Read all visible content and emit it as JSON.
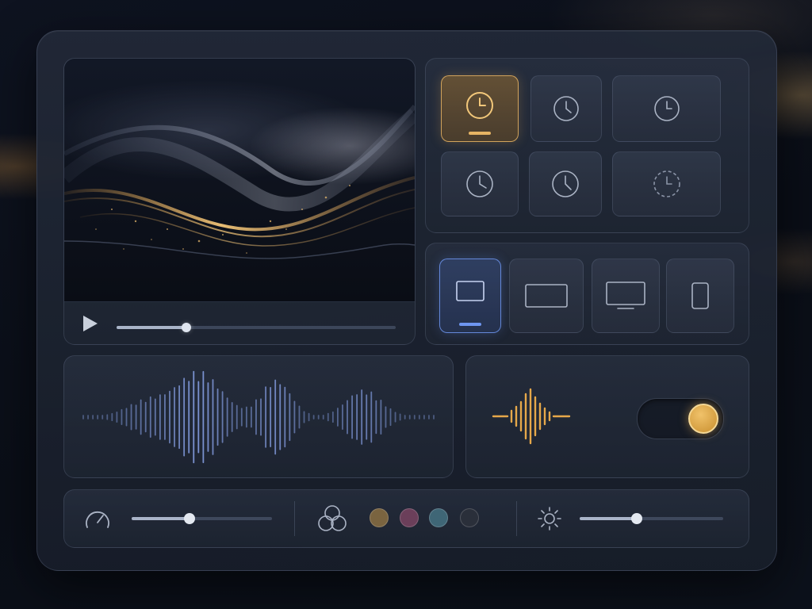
{
  "video": {
    "progress": 0.25
  },
  "clock_presets": [
    {
      "icon": "clock-icon",
      "active": true
    },
    {
      "icon": "clock-icon",
      "active": false
    },
    {
      "icon": "clock-icon",
      "active": false
    },
    {
      "icon": "clock-icon",
      "active": false
    },
    {
      "icon": "clock-icon",
      "active": false
    },
    {
      "icon": "clock-dashed-icon",
      "active": false
    }
  ],
  "screen_formats": [
    {
      "icon": "tablet-landscape-icon",
      "active": true
    },
    {
      "icon": "widescreen-icon",
      "active": false
    },
    {
      "icon": "monitor-icon",
      "active": false
    },
    {
      "icon": "phone-portrait-icon",
      "active": false
    }
  ],
  "audio": {
    "toggle_on": true
  },
  "controls": {
    "speed_level": 0.41,
    "brightness_level": 0.4,
    "swatches": [
      "#7a6440",
      "#6b3f5a",
      "#3f6676",
      "#2a2f3a"
    ]
  },
  "colors": {
    "accent_gold": "#e6b464",
    "accent_blue": "#6e96f0",
    "wave_blue": "#7f97d8"
  }
}
